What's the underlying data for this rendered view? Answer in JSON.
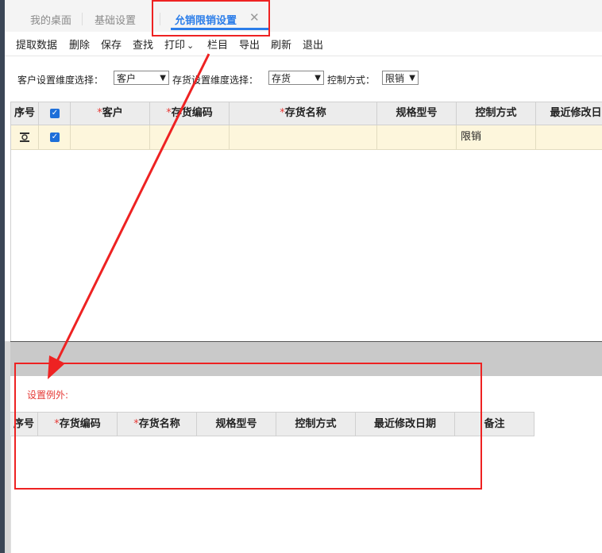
{
  "tabs": [
    {
      "label": "我的桌面",
      "active": false
    },
    {
      "label": "基础设置",
      "active": false
    },
    {
      "label": "允销限销设置",
      "active": true
    }
  ],
  "tab_close_glyph": "✕",
  "toolbar": {
    "items": [
      "提取数据",
      "删除",
      "保存",
      "查找",
      "打印",
      "栏目",
      "导出",
      "刷新",
      "退出"
    ],
    "print_dropdown": "⌄"
  },
  "filters": {
    "customer_dim_label": "客户设置维度选择：",
    "customer_dim_value": "客户",
    "stock_dim_label": "存货设置维度选择：",
    "stock_dim_value": "存货",
    "control_label": "控制方式：",
    "control_value": "限销"
  },
  "main_grid": {
    "headers": [
      "序号",
      "",
      "客户",
      "存货编码",
      "存货名称",
      "规格型号",
      "控制方式",
      "最近修改日"
    ],
    "required_mark": "*",
    "rows": [
      {
        "seq_icon": "row-insert-icon",
        "checked": true,
        "customer": "",
        "code": "",
        "name": "",
        "spec": "",
        "control": "限销",
        "modified": ""
      }
    ]
  },
  "exception": {
    "label": "设置例外:",
    "headers": [
      "序号",
      "存货编码",
      "存货名称",
      "规格型号",
      "控制方式",
      "最近修改日期",
      "备注"
    ]
  },
  "colors": {
    "accent": "#2b7de9",
    "annotation_red": "#ee2222",
    "row_highlight": "#fdf6dc",
    "checkbox_blue": "#1e6fd9"
  }
}
